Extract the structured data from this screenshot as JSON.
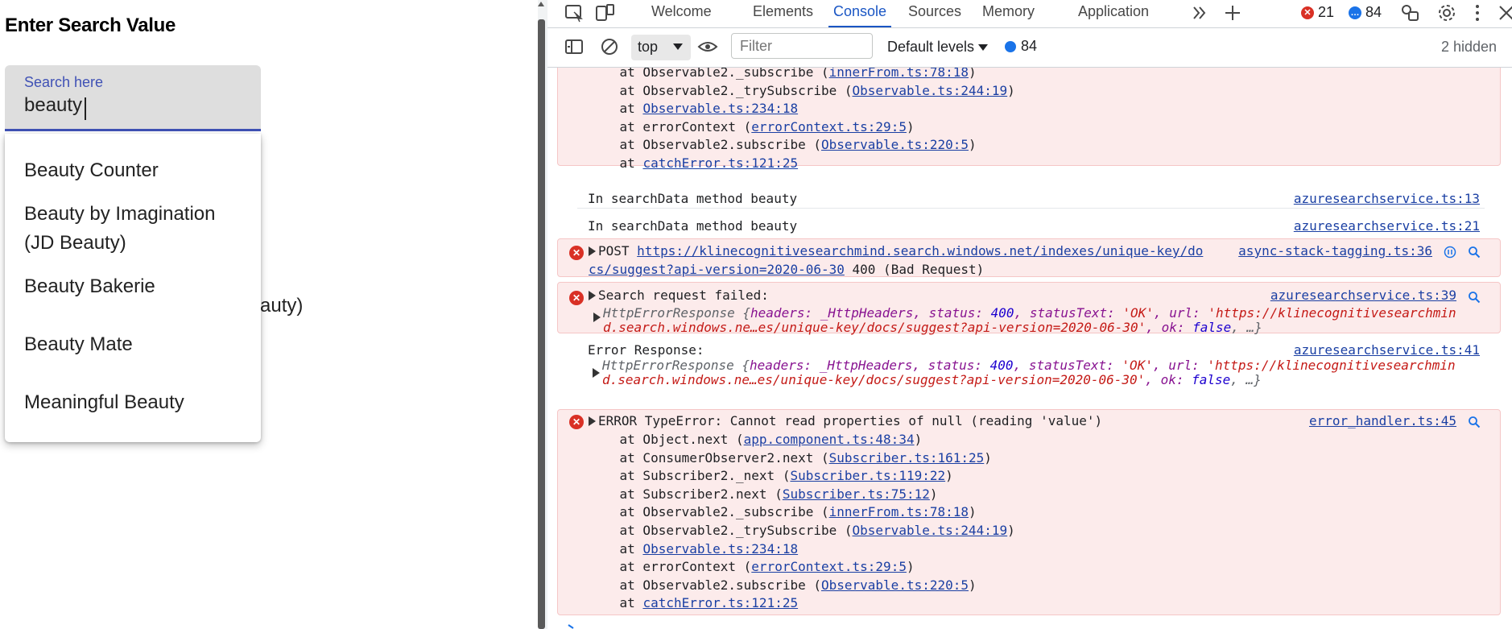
{
  "app": {
    "heading": "Enter Search Value",
    "search": {
      "label": "Search here",
      "value": "beauty"
    },
    "options": [
      "Beauty Counter",
      "Beauty by Imagination",
      "(JD Beauty)",
      "Beauty Bakerie",
      "Beauty Mate",
      "Meaningful Beauty"
    ],
    "occluded_text": "auty)"
  },
  "devtools": {
    "tabs": [
      "Welcome",
      "Elements",
      "Console",
      "Sources",
      "Memory",
      "Application"
    ],
    "active_tab": "Console",
    "error_count": "21",
    "message_count": "84",
    "toolbar": {
      "context": "top",
      "filter_placeholder": "Filter",
      "levels": "Default levels",
      "message_count": "84",
      "hidden": "2 hidden"
    },
    "console": {
      "stack1": [
        {
          "pre": "    at Observable2._subscribe (",
          "link": "innerFrom.ts:78:18",
          "post": ")"
        },
        {
          "pre": "    at Observable2._trySubscribe (",
          "link": "Observable.ts:244:19",
          "post": ")"
        },
        {
          "pre": "    at ",
          "link": "Observable.ts:234:18",
          "post": ""
        },
        {
          "pre": "    at errorContext (",
          "link": "errorContext.ts:29:5",
          "post": ")"
        },
        {
          "pre": "    at Observable2.subscribe (",
          "link": "Observable.ts:220:5",
          "post": ")"
        },
        {
          "pre": "    at ",
          "link": "catchError.ts:121:25",
          "post": ""
        }
      ],
      "log1": {
        "text": "In searchData method beauty",
        "source": "azuresearchservice.ts:13"
      },
      "log2": {
        "text": "In searchData method beauty",
        "source": "azuresearchservice.ts:21"
      },
      "post_error": {
        "method": "POST",
        "url_line1": "https://klinecognitivesearchmind.search.windows.net/indexes/unique-key/do",
        "url_line2": "cs/suggest?api-version=2020-06-30",
        "status": " 400 (Bad Request)",
        "source": "async-stack-tagging.ts:36"
      },
      "search_failed": {
        "text": "Search request failed:",
        "source": "azuresearchservice.ts:39",
        "obj_line1_a": "HttpErrorResponse {",
        "obj_line1_b": "headers: _HttpHeaders, status: ",
        "obj_line1_c": "400",
        "obj_line1_d": ", statusText: ",
        "obj_line1_e": "'OK'",
        "obj_line1_f": ", url: ",
        "obj_line1_g": "'https://klinecognitivesearchmin",
        "obj_line2_a": "d.search.windows.ne…es/unique-key/docs/suggest?api-version=2020-06-30'",
        "obj_line2_b": ", ok: ",
        "obj_line2_c": "false",
        "obj_line2_d": ", …}"
      },
      "error_response": {
        "text": "Error Response:",
        "source": "azuresearchservice.ts:41"
      },
      "type_error": {
        "text": "ERROR TypeError: Cannot read properties of null (reading 'value')",
        "source": "error_handler.ts:45"
      },
      "stack2": [
        {
          "pre": "    at Object.next (",
          "link": "app.component.ts:48:34",
          "post": ")"
        },
        {
          "pre": "    at ConsumerObserver2.next (",
          "link": "Subscriber.ts:161:25",
          "post": ")"
        },
        {
          "pre": "    at Subscriber2._next (",
          "link": "Subscriber.ts:119:22",
          "post": ")"
        },
        {
          "pre": "    at Subscriber2.next (",
          "link": "Subscriber.ts:75:12",
          "post": ")"
        },
        {
          "pre": "    at Observable2._subscribe (",
          "link": "innerFrom.ts:78:18",
          "post": ")"
        },
        {
          "pre": "    at Observable2._trySubscribe (",
          "link": "Observable.ts:244:19",
          "post": ")"
        },
        {
          "pre": "    at ",
          "link": "Observable.ts:234:18",
          "post": ""
        },
        {
          "pre": "    at errorContext (",
          "link": "errorContext.ts:29:5",
          "post": ")"
        },
        {
          "pre": "    at Observable2.subscribe (",
          "link": "Observable.ts:220:5",
          "post": ")"
        },
        {
          "pre": "    at ",
          "link": "catchError.ts:121:25",
          "post": ""
        }
      ]
    }
  }
}
